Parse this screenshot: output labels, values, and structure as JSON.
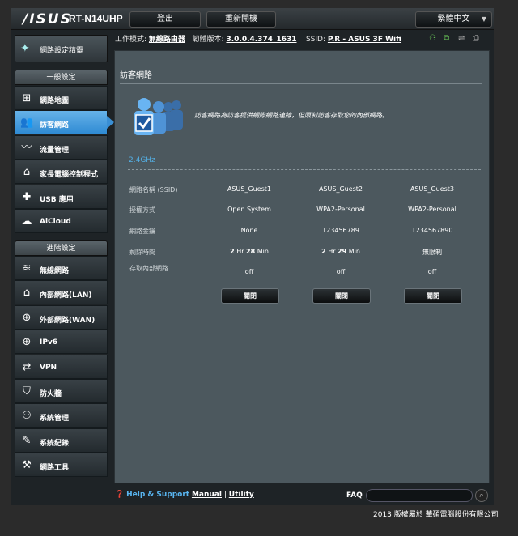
{
  "header": {
    "brand": "/ISUS",
    "model": "RT-N14UHP",
    "logout_label": "登出",
    "reboot_label": "重新開機",
    "language": "繁體中文"
  },
  "status": {
    "mode_label": "工作模式:",
    "mode_value": "無線路由器",
    "firmware_label": "韌體版本:",
    "firmware_value": "3.0.0.4.374_1631",
    "ssid_label": "SSID:",
    "ssid_value": "P.R - ASUS 3F Wifi"
  },
  "sidebar": {
    "qis_label": "網路設定精靈",
    "general_header": "一般設定",
    "general_items": [
      {
        "label": "網路地圖",
        "icon": "network-map-icon"
      },
      {
        "label": "訪客網路",
        "icon": "guest-network-icon",
        "active": true
      },
      {
        "label": "流量管理",
        "icon": "traffic-manager-icon"
      },
      {
        "label": "家長電腦控制程式",
        "icon": "parental-control-icon"
      },
      {
        "label": "USB 應用",
        "icon": "usb-application-icon"
      },
      {
        "label": "AiCloud",
        "icon": "aicloud-icon"
      }
    ],
    "advanced_header": "進階設定",
    "advanced_items": [
      {
        "label": "無線網路",
        "icon": "wireless-icon"
      },
      {
        "label": "內部網路(LAN)",
        "icon": "lan-icon"
      },
      {
        "label": "外部網路(WAN)",
        "icon": "wan-icon"
      },
      {
        "label": "IPv6",
        "icon": "ipv6-icon"
      },
      {
        "label": "VPN",
        "icon": "vpn-icon"
      },
      {
        "label": "防火牆",
        "icon": "firewall-icon"
      },
      {
        "label": "系統管理",
        "icon": "administration-icon"
      },
      {
        "label": "系統紀錄",
        "icon": "system-log-icon"
      },
      {
        "label": "網路工具",
        "icon": "network-tools-icon"
      }
    ]
  },
  "main": {
    "title": "訪客網路",
    "description": "訪客網路為訪客提供網際網路連線，但限制訪客存取您的內部網路。",
    "band": "2.4GHz",
    "row_labels": [
      "網路名稱 (SSID)",
      "授權方式",
      "網路金鑰",
      "剩餘時間",
      "存取內部網路"
    ],
    "guests": [
      {
        "ssid": "ASUS_Guest1",
        "auth": "Open System",
        "key": "None",
        "time_hr": "2",
        "time_min": "28",
        "intranet": "off",
        "button": "關閉"
      },
      {
        "ssid": "ASUS_Guest2",
        "auth": "WPA2-Personal",
        "key": "123456789",
        "time_hr": "2",
        "time_min": "29",
        "intranet": "off",
        "button": "關閉"
      },
      {
        "ssid": "ASUS_Guest3",
        "auth": "WPA2-Personal",
        "key": "1234567890",
        "time_text": "無限制",
        "intranet": "off",
        "button": "關閉"
      }
    ],
    "hr_unit": "Hr",
    "min_unit": "Min"
  },
  "footer": {
    "help": "Help & Support",
    "manual": "Manual",
    "separator": "|",
    "utility": "Utility",
    "faq": "FAQ",
    "copyright": "2013 版權屬於 華碩電腦股份有限公司"
  },
  "colors": {
    "accent": "#3a8fd4",
    "panel": "#4c585e",
    "band": "#54b0e6"
  }
}
